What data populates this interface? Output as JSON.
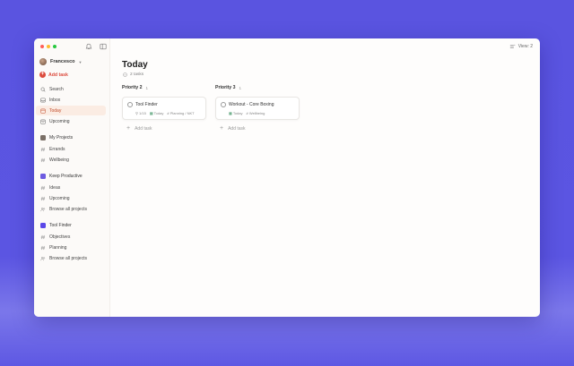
{
  "sidebar": {
    "user_name": "Francesco",
    "add_task_label": "Add task",
    "nav": [
      {
        "label": "Search",
        "icon": "search-icon"
      },
      {
        "label": "Inbox",
        "icon": "inbox-icon"
      },
      {
        "label": "Today",
        "icon": "calendar-today-icon",
        "active": true
      },
      {
        "label": "Upcoming",
        "icon": "calendar-icon"
      }
    ],
    "sections": [
      {
        "title": "My Projects",
        "color": "#7a6f66",
        "items": [
          "Errands",
          "Wellbeing"
        ]
      },
      {
        "title": "Keep Productive",
        "color": "#6d5be0",
        "items": [
          "Ideas",
          "Upcoming",
          "Browse all projects"
        ]
      },
      {
        "title": "Tool Finder",
        "color": "#5b48e8",
        "items": [
          "Objectives",
          "Planning",
          "Browse all projects"
        ]
      }
    ]
  },
  "main": {
    "view_label": "View",
    "view_badge": "2",
    "title": "Today",
    "task_count": "2 tasks",
    "columns": [
      {
        "title": "Priority 2",
        "count": "1",
        "card": {
          "name": "Tool Finder",
          "meta": [
            "1/15",
            "Today",
            "Planning / NKT"
          ]
        },
        "add_label": "Add task"
      },
      {
        "title": "Priority 3",
        "count": "1",
        "card": {
          "name": "Workout - Core Boxing",
          "meta": [
            "Today",
            "Wellbeing"
          ]
        },
        "add_label": "Add task"
      }
    ]
  },
  "colors": {
    "accent": "#dc4c3e",
    "active_bg": "#fbece3",
    "background": "#5a54e0"
  }
}
